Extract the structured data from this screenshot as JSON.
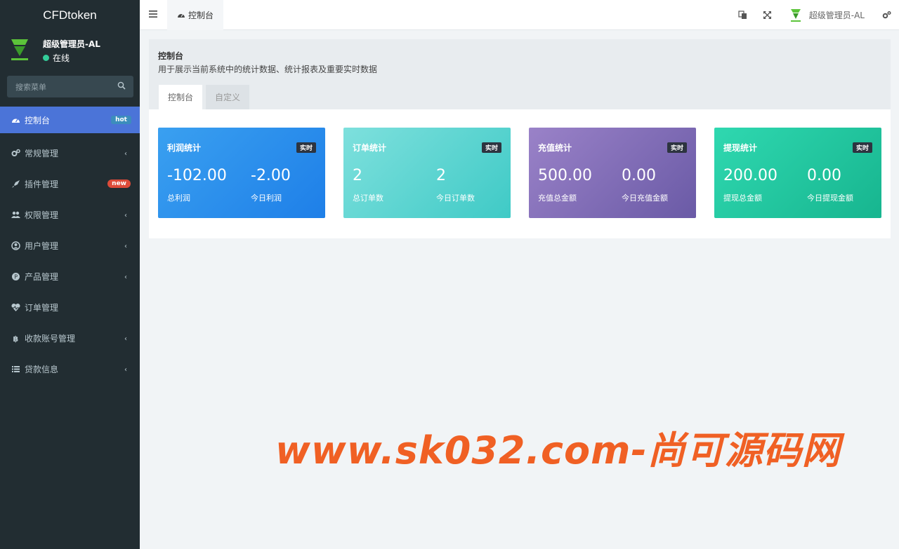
{
  "brand": "CFDtoken",
  "user": {
    "name": "超级管理员-AL",
    "status": "在线"
  },
  "search": {
    "placeholder": "搜索菜单"
  },
  "menu": [
    {
      "label": "控制台",
      "badge": "hot",
      "icon": "dashboard-icon"
    },
    {
      "label": "常规管理",
      "icon": "cogs-icon"
    },
    {
      "label": "插件管理",
      "badge": "new",
      "icon": "rocket-icon"
    },
    {
      "label": "权限管理",
      "icon": "users-icon"
    },
    {
      "label": "用户管理",
      "icon": "user-circle-icon"
    },
    {
      "label": "产品管理",
      "icon": "product-icon"
    },
    {
      "label": "订单管理",
      "icon": "heartbeat-icon"
    },
    {
      "label": "收款账号管理",
      "icon": "bitcoin-icon"
    },
    {
      "label": "贷款信息",
      "icon": "list-icon"
    }
  ],
  "header": {
    "tab": "控制台",
    "user": "超级管理员-AL"
  },
  "content": {
    "title": "控制台",
    "subtitle": "用于展示当前系统中的统计数据、统计报表及重要实时数据",
    "tabs": [
      "控制台",
      "自定义"
    ]
  },
  "cards": [
    {
      "title": "利润统计",
      "tag": "实时",
      "v1": "-102.00",
      "l1": "总利润",
      "v2": "-2.00",
      "l2": "今日利润"
    },
    {
      "title": "订单统计",
      "tag": "实时",
      "v1": "2",
      "l1": "总订单数",
      "v2": "2",
      "l2": "今日订单数"
    },
    {
      "title": "充值统计",
      "tag": "实时",
      "v1": "500.00",
      "l1": "充值总金额",
      "v2": "0.00",
      "l2": "今日充值金额"
    },
    {
      "title": "提现统计",
      "tag": "实时",
      "v1": "200.00",
      "l1": "提现总金额",
      "v2": "0.00",
      "l2": "今日提现金额"
    }
  ],
  "watermark": "www.sk032.com-尚可源码网",
  "colors": {
    "sidebar": "#222d32",
    "active": "#4b74d8",
    "watermark": "#f06024"
  }
}
